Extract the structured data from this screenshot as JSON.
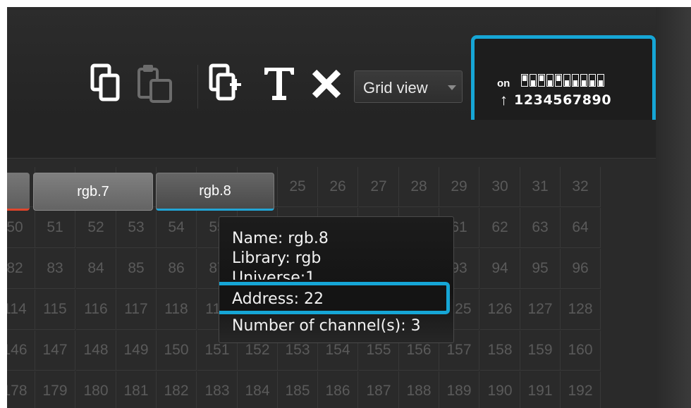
{
  "toolbar": {
    "icons": [
      "copy-icon",
      "paste-icon",
      "add-fixture-icon",
      "text-icon",
      "delete-icon"
    ],
    "view_select": {
      "value": "Grid view"
    }
  },
  "dip_switch": {
    "on_label": "on",
    "numbers": "1234567890",
    "states": [
      1,
      0,
      1,
      0,
      1,
      0,
      0,
      0,
      0,
      0
    ]
  },
  "fixtures": [
    {
      "label": ""
    },
    {
      "label": "rgb.7"
    },
    {
      "label": "rgb.8"
    }
  ],
  "grid": {
    "rows": [
      [
        "",
        "",
        "",
        "",
        "",
        "",
        "",
        "25",
        "26",
        "27",
        "28",
        "29",
        "30",
        "31",
        "32"
      ],
      [
        "50",
        "51",
        "52",
        "53",
        "54",
        "55",
        "",
        "",
        "",
        "",
        "",
        "61",
        "62",
        "63",
        "64"
      ],
      [
        "82",
        "83",
        "84",
        "85",
        "86",
        "87",
        "",
        "",
        "",
        "",
        "",
        "93",
        "94",
        "95",
        "96"
      ],
      [
        "114",
        "115",
        "116",
        "117",
        "118",
        "119",
        "",
        "",
        "",
        "",
        "",
        "125",
        "126",
        "127",
        "128"
      ],
      [
        "146",
        "147",
        "148",
        "149",
        "150",
        "151",
        "152",
        "153",
        "154",
        "155",
        "156",
        "157",
        "158",
        "159",
        "160"
      ],
      [
        "178",
        "179",
        "180",
        "181",
        "182",
        "183",
        "184",
        "185",
        "186",
        "187",
        "188",
        "189",
        "190",
        "191",
        "192"
      ]
    ]
  },
  "tooltip": {
    "name": "Name: rgb.8",
    "library": "Library: rgb",
    "universe": "Universe:1",
    "address": "Address: 22",
    "channels": "Number of channel(s): 3"
  },
  "colors": {
    "accent": "#16a6d6",
    "selection_red": "#e0452c"
  }
}
